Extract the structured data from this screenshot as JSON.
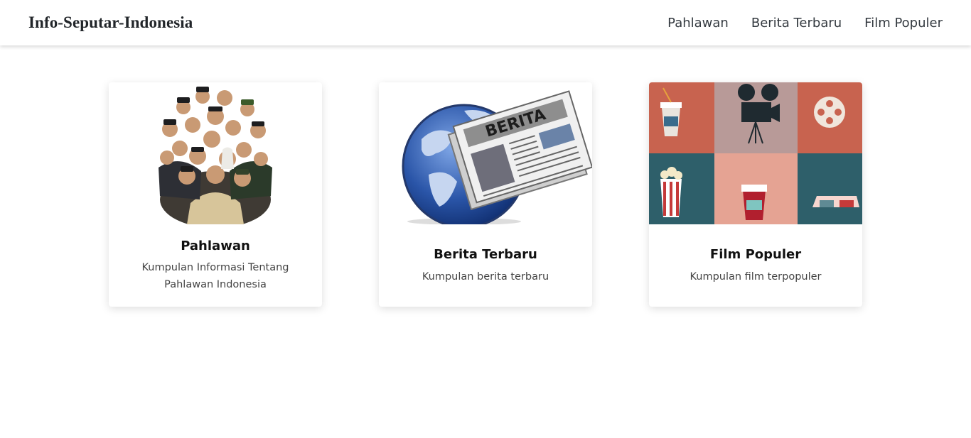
{
  "navbar": {
    "brand": "Info-Seputar-Indonesia",
    "links": [
      "Pahlawan",
      "Berita Terbaru",
      "Film Populer"
    ]
  },
  "cards": [
    {
      "title": "Pahlawan",
      "text": "Kumpulan Informasi Tentang Pahlawan Indonesia",
      "image": "heroes-collage"
    },
    {
      "title": "Berita Terbaru",
      "text": "Kumpulan berita terbaru",
      "image": "newspaper-globe",
      "image_label": "BERITA"
    },
    {
      "title": "Film Populer",
      "text": "Kumpulan film terpopuler",
      "image": "film-icons-grid"
    }
  ],
  "colors": {
    "coral": "#c8634f",
    "mauve": "#b89a98",
    "teal": "#2e5f6a",
    "salmon": "#e5a393",
    "globe": "#2a55a8"
  }
}
